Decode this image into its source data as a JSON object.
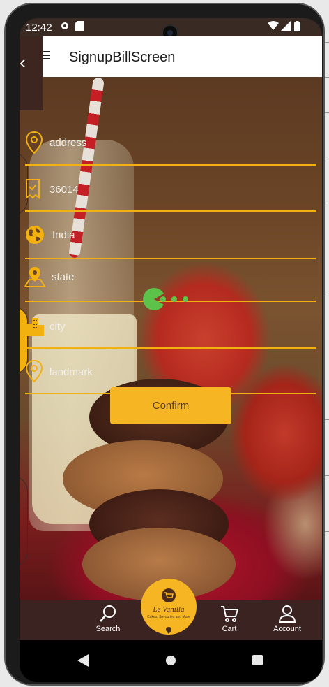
{
  "status_bar": {
    "time": "12:42",
    "icons": [
      "gear-icon",
      "sd-card-icon",
      "wifi-icon",
      "cellular-icon",
      "battery-icon"
    ]
  },
  "app_bar": {
    "title": "SignupBillScreen",
    "back_glyph": "‹"
  },
  "form": {
    "fields": [
      {
        "icon": "location-pin-icon",
        "value": "address"
      },
      {
        "icon": "receipt-icon",
        "value": "36014"
      },
      {
        "icon": "globe-icon",
        "value": "India"
      },
      {
        "icon": "map-pin-icon",
        "value": "state"
      },
      {
        "icon": "city-buildings-icon",
        "value": "city"
      },
      {
        "icon": "location-pin-icon",
        "value": "landmark"
      }
    ],
    "confirm_label": "Confirm"
  },
  "bottom_nav": {
    "items": [
      {
        "label": "Search",
        "icon": "search-icon"
      },
      {
        "label": "Cart",
        "icon": "cart-icon"
      },
      {
        "label": "Account",
        "icon": "account-icon"
      }
    ],
    "center_brand": "Le Vanilla",
    "center_tagline": "Cakes, Savouries and More"
  },
  "colors": {
    "accent": "#f6b523",
    "field_line": "#f2b10f",
    "nav_bg": "#3a2320",
    "loader": "#5cc24a",
    "status_bar_bg": "#3a2a24"
  }
}
